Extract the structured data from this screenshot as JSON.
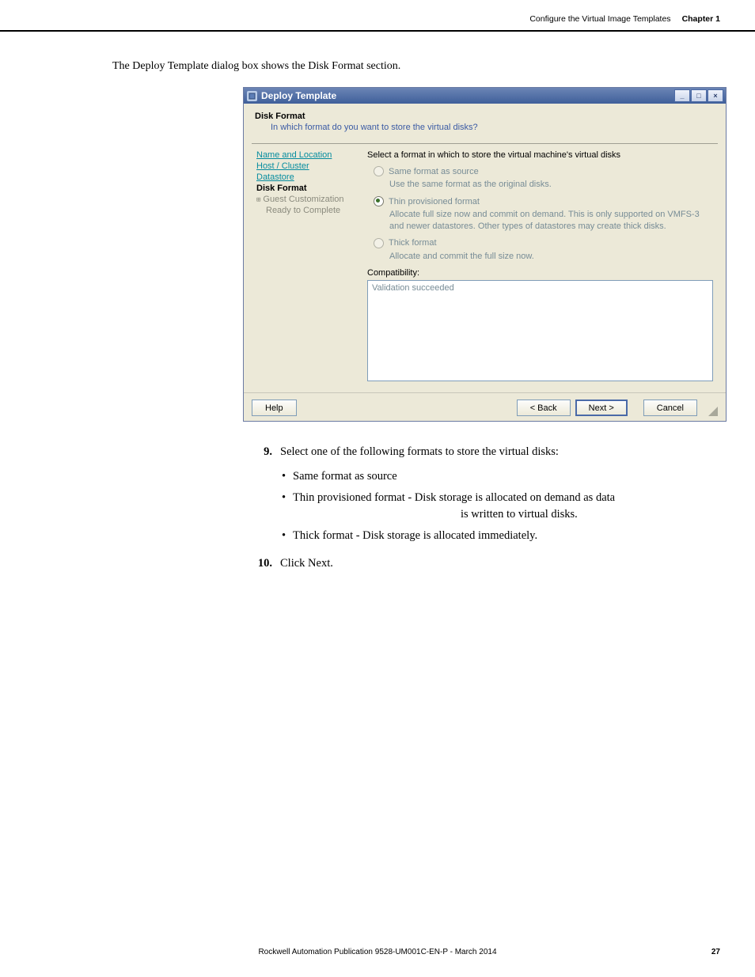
{
  "header": {
    "section": "Configure the Virtual Image Templates",
    "chapter": "Chapter 1"
  },
  "caption": "The Deploy Template dialog box shows the Disk Format section.",
  "dialog": {
    "title": "Deploy Template",
    "heading": "Disk Format",
    "subheading": "In which format do you want to store the virtual disks?",
    "nav": {
      "name_location": "Name and Location",
      "host_cluster": "Host / Cluster",
      "datastore": "Datastore",
      "disk_format": "Disk Format",
      "guest_custom": "Guest Customization",
      "ready": "Ready to Complete"
    },
    "main": {
      "intro": "Select a format in which to store the virtual machine's virtual disks",
      "same_label": "Same format as source",
      "same_desc": "Use the same format as the original disks.",
      "thin_label": "Thin provisioned format",
      "thin_desc": "Allocate full size now and commit on demand. This is only supported on VMFS-3 and newer datastores. Other types of datastores may create thick disks.",
      "thick_label": "Thick format",
      "thick_desc": "Allocate and commit the full size now.",
      "compat_label": "Compatibility:",
      "compat_value": "Validation succeeded"
    },
    "buttons": {
      "help": "Help",
      "back": "< Back",
      "next": "Next >",
      "cancel": "Cancel"
    }
  },
  "content": {
    "step9_num": "9.",
    "step9_text": "Select one of the following formats to store the virtual disks:",
    "b1": "Same format as source",
    "b2a": "Thin provisioned format - Disk storage is allocated on demand as data",
    "b2b": "is written to virtual disks.",
    "b3": "Thick format - Disk storage is allocated immediately.",
    "step10_num": "10.",
    "step10_text": "Click Next."
  },
  "footer": {
    "pub": "Rockwell Automation Publication 9528-UM001C-EN-P - March 2014",
    "page": "27"
  }
}
